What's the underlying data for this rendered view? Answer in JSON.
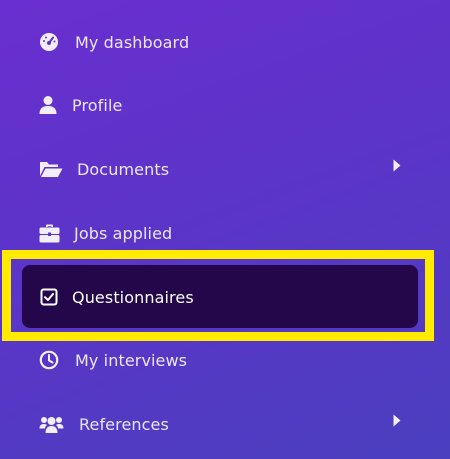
{
  "sidebar": {
    "items": [
      {
        "label": "My dashboard",
        "icon": "dashboard-gauge-icon",
        "has_submenu": false
      },
      {
        "label": "Profile",
        "icon": "user-icon",
        "has_submenu": false
      },
      {
        "label": "Documents",
        "icon": "folder-open-icon",
        "has_submenu": true
      },
      {
        "label": "Jobs applied",
        "icon": "briefcase-icon",
        "has_submenu": false
      },
      {
        "label": "Questionnaires",
        "icon": "checkbox-icon",
        "has_submenu": false,
        "active": true
      },
      {
        "label": "My interviews",
        "icon": "clock-icon",
        "has_submenu": false
      },
      {
        "label": "References",
        "icon": "users-group-icon",
        "has_submenu": true
      }
    ],
    "colors": {
      "gradient_start": "#6a2fd0",
      "gradient_end": "#4b3fbf",
      "active_background": "#24074a",
      "highlight_outline": "#ffeb00",
      "text": "#ece6fb"
    }
  }
}
